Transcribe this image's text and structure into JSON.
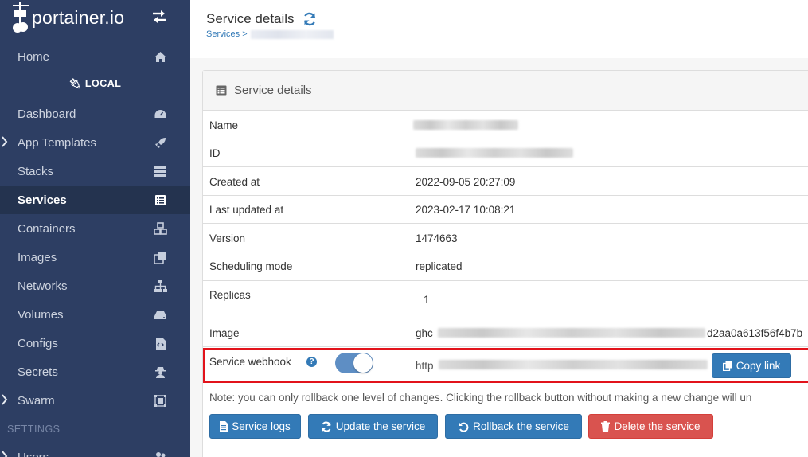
{
  "sidebar": {
    "brand": "portainer.io",
    "environment": "LOCAL",
    "items": [
      {
        "label": "Home",
        "icon": "home-icon"
      },
      {
        "label": "Dashboard",
        "icon": "dashboard-icon"
      },
      {
        "label": "App Templates",
        "icon": "rocket-icon"
      },
      {
        "label": "Stacks",
        "icon": "stacks-icon"
      },
      {
        "label": "Services",
        "icon": "services-icon"
      },
      {
        "label": "Containers",
        "icon": "cubes-icon"
      },
      {
        "label": "Images",
        "icon": "clone-icon"
      },
      {
        "label": "Networks",
        "icon": "sitemap-icon"
      },
      {
        "label": "Volumes",
        "icon": "hdd-icon"
      },
      {
        "label": "Configs",
        "icon": "file-code-icon"
      },
      {
        "label": "Secrets",
        "icon": "user-secret-icon"
      },
      {
        "label": "Swarm",
        "icon": "object-group-icon"
      },
      {
        "label": "Users",
        "icon": "users-icon"
      }
    ],
    "settings_heading": "SETTINGS"
  },
  "header": {
    "title": "Service details",
    "breadcrumb_root": "Services",
    "breadcrumb_sep": ">"
  },
  "panel": {
    "title": "Service details",
    "rows": {
      "name_label": "Name",
      "id_label": "ID",
      "created_label": "Created at",
      "created_value": "2022-09-05 20:27:09",
      "updated_label": "Last updated at",
      "updated_value": "2023-02-17 10:08:21",
      "version_label": "Version",
      "version_value": "1474663",
      "mode_label": "Scheduling mode",
      "mode_value": "replicated",
      "replicas_label": "Replicas",
      "replicas_value": "1",
      "image_label": "Image",
      "image_prefix": "ghc",
      "image_suffix": "d2aa0a613f56f4b7b",
      "webhook_label": "Service webhook",
      "webhook_help": "?",
      "webhook_enabled": true,
      "webhook_prefix": "http",
      "copy_link": "Copy link"
    },
    "note": "Note: you can only rollback one level of changes. Clicking the rollback button without making a new change will un",
    "buttons": {
      "logs": "Service logs",
      "update": "Update the service",
      "rollback": "Rollback the service",
      "delete": "Delete the service"
    }
  },
  "colors": {
    "sidebar_bg": "#2d3e63",
    "primary": "#337ab7",
    "danger": "#d9534f",
    "highlight": "#e2131b"
  }
}
